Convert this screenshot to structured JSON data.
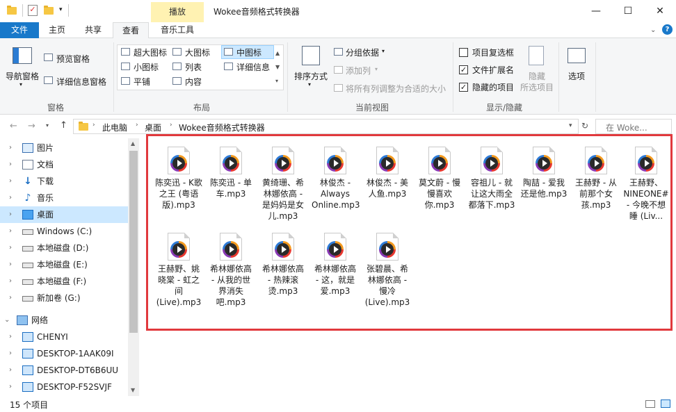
{
  "window": {
    "title": "Wokee音频格式转换器",
    "context_tab": "播放",
    "controls": [
      "—",
      "☐",
      "✕"
    ]
  },
  "tabs": [
    {
      "label": "文件"
    },
    {
      "label": "主页"
    },
    {
      "label": "共享"
    },
    {
      "label": "查看"
    },
    {
      "label": "音乐工具"
    }
  ],
  "ribbon": {
    "pane": {
      "nav_label": "导航窗格",
      "preview": "预览窗格",
      "details": "详细信息窗格",
      "group": "窗格"
    },
    "layout": {
      "items": [
        "超大图标",
        "大图标",
        "中图标",
        "小图标",
        "列表",
        "详细信息",
        "平铺",
        "内容"
      ],
      "group": "布局"
    },
    "current_view": {
      "sort": "排序方式",
      "group_by": "分组依据",
      "add_column": "添加列",
      "fit_columns": "将所有列调整为合适的大小",
      "group": "当前视图"
    },
    "show_hide": {
      "item_checkboxes": "项目复选框",
      "extensions": "文件扩展名",
      "hidden_items": "隐藏的项目",
      "hide_selected_1": "隐藏",
      "hide_selected_2": "所选项目",
      "group": "显示/隐藏"
    },
    "options": "选项"
  },
  "address": {
    "crumbs": [
      "此电脑",
      "桌面",
      "Wokee音频格式转换器"
    ],
    "search_placeholder": "在 Woke..."
  },
  "nav": [
    {
      "label": "图片"
    },
    {
      "label": "文档"
    },
    {
      "label": "下载"
    },
    {
      "label": "音乐"
    },
    {
      "label": "桌面"
    },
    {
      "label": "Windows (C:)"
    },
    {
      "label": "本地磁盘 (D:)"
    },
    {
      "label": "本地磁盘 (E:)"
    },
    {
      "label": "本地磁盘 (F:)"
    },
    {
      "label": "新加卷 (G:)"
    },
    {
      "label": "网络"
    },
    {
      "label": "CHENYI"
    },
    {
      "label": "DESKTOP-1AAK09I"
    },
    {
      "label": "DESKTOP-DT6B6UU"
    },
    {
      "label": "DESKTOP-F52SVJF"
    }
  ],
  "files": [
    {
      "name": "陈奕迅 - K歌之王 (粤语版).mp3"
    },
    {
      "name": "陈奕迅 - 单车.mp3"
    },
    {
      "name": "黄绮珊、希林娜依高 - 是妈妈是女儿.mp3"
    },
    {
      "name": "林俊杰 - Always Online.mp3"
    },
    {
      "name": "林俊杰 - 美人鱼.mp3"
    },
    {
      "name": "莫文蔚 - 慢慢喜欢你.mp3"
    },
    {
      "name": "容祖儿 - 就让这大雨全都落下.mp3"
    },
    {
      "name": "陶喆 - 爱我还是他.mp3"
    },
    {
      "name": "王赫野 - 从前那个女孩.mp3"
    },
    {
      "name": "王赫野、NINEONE# - 今晚不想睡 (Liv..."
    },
    {
      "name": "王赫野、姚晓棠 - 虹之间 (Live).mp3"
    },
    {
      "name": "希林娜依高 - 从我的世界消失吧.mp3"
    },
    {
      "name": "希林娜依高 - 热辣滚烫.mp3"
    },
    {
      "name": "希林娜依高 - 这，就是爱.mp3"
    },
    {
      "name": "张碧晨、希林娜依高 - 慢冷 (Live).mp3"
    }
  ],
  "status": {
    "count": "15 个项目"
  },
  "colors": {
    "file_tab": "#1979ca",
    "selection": "#cce8ff",
    "highlight_border": "#e1393d",
    "context_tab": "#fff2b2"
  }
}
